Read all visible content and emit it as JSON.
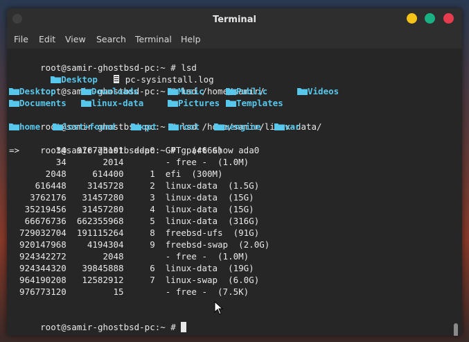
{
  "window": {
    "title": "Terminal"
  },
  "menu": [
    "File",
    "Edit",
    "View",
    "Search",
    "Terminal",
    "Help"
  ],
  "colors": {
    "directory": "#57c7ec",
    "text": "#e8e8e8",
    "background": "#262626",
    "minimize": "#f5c318",
    "maximize": "#19b184",
    "close": "#e73c4e"
  },
  "terminal": {
    "prompt": "root@samir-ghostbsd-pc:~ #",
    "commands": {
      "c1": "lsd",
      "c2": "lsd /home/samir/",
      "c3": "lsd /home/samir/linux-data/",
      "c4": "gpart show ada0"
    },
    "ls1": [
      {
        "name": "Desktop",
        "type": "folder"
      },
      {
        "name": "pc-sysinstall.log",
        "type": "file"
      }
    ],
    "ls2_row1": [
      "Desktop",
      "Downloads",
      "Music",
      "Public",
      "Videos"
    ],
    "ls2_row2": [
      "Documents",
      "linux-data",
      "Pictures",
      "Templates"
    ],
    "ls3": [
      "home",
      "lost+found",
      "opt",
      "root",
      "uengine",
      "var"
    ],
    "gpart_header": "=>       34  976773101  ada0  GPT  (466G)",
    "gpart_rows": [
      "         34       2014        - free -  (1.0M)",
      "       2048     614400     1  efi  (300M)",
      "     616448    3145728     2  linux-data  (1.5G)",
      "    3762176   31457280     3  linux-data  (15G)",
      "   35219456   31457280     4  linux-data  (15G)",
      "   66676736  662355968     5  linux-data  (316G)",
      "  729032704  191115264     8  freebsd-ufs  (91G)",
      "  920147968    4194304     9  freebsd-swap  (2.0G)",
      "  924342272       2048        - free -  (1.0M)",
      "  924344320   39845888     6  linux-data  (19G)",
      "  964190208   12582912     7  linux-swap  (6.0G)",
      "  976773120         15        - free -  (7.5K)"
    ]
  }
}
